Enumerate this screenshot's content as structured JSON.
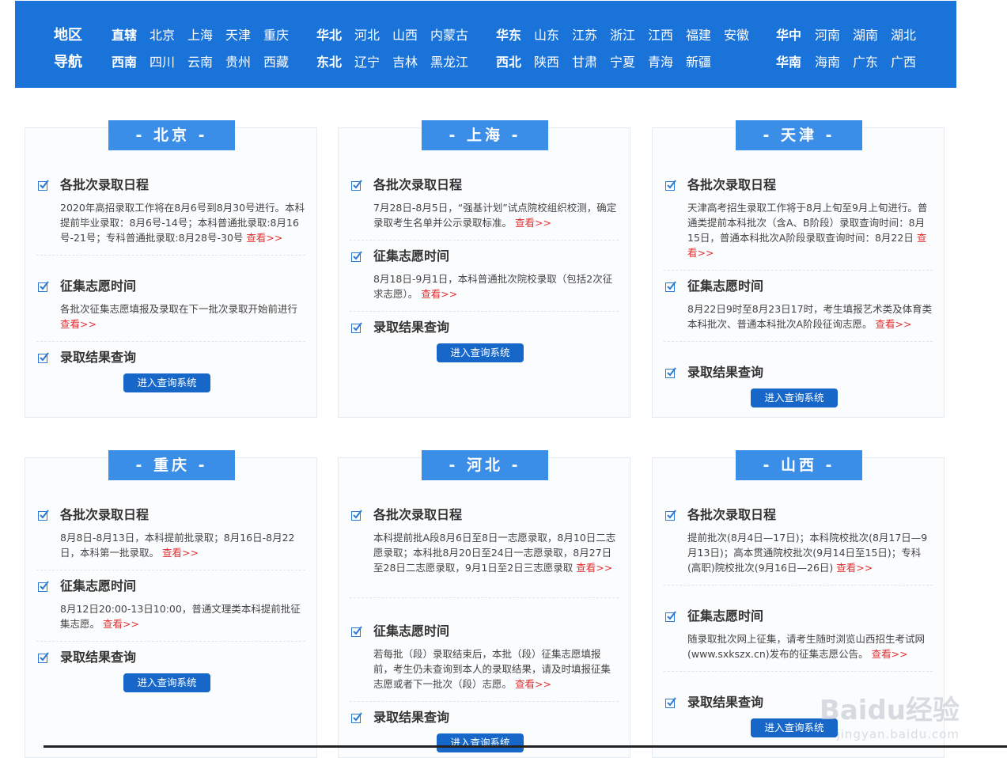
{
  "nav": {
    "title_line1": "地区",
    "title_line2": "导航",
    "row1": [
      {
        "region": "直辖",
        "provinces": [
          "北京",
          "上海",
          "天津",
          "重庆"
        ]
      },
      {
        "region": "华北",
        "provinces": [
          "河北",
          "山西",
          "内蒙古"
        ]
      },
      {
        "region": "华东",
        "provinces": [
          "山东",
          "江苏",
          "浙江",
          "江西",
          "福建",
          "安徽"
        ]
      },
      {
        "region": "华中",
        "provinces": [
          "河南",
          "湖南",
          "湖北"
        ]
      }
    ],
    "row2": [
      {
        "region": "西南",
        "provinces": [
          "四川",
          "云南",
          "贵州",
          "西藏"
        ]
      },
      {
        "region": "东北",
        "provinces": [
          "辽宁",
          "吉林",
          "黑龙江"
        ]
      },
      {
        "region": "西北",
        "provinces": [
          "陕西",
          "甘肃",
          "宁夏",
          "青海",
          "新疆"
        ]
      },
      {
        "region": "华南",
        "provinces": [
          "海南",
          "广东",
          "广西"
        ]
      }
    ]
  },
  "more_label": "查看>>",
  "query_button_label": "进入查询系统",
  "cards": [
    {
      "name": "- 北京 -",
      "schedule_title": "各批次录取日程",
      "schedule_text": "2020年高招录取工作将在8月6号到8月30号进行。本科提前毕业录取：8月6号-14号；本科普通批录取:8月16号-21号；专科普通批录取:8月28号-30号",
      "solicit_title": "征集志愿时间",
      "solicit_text": "各批次征集志愿填报及录取在下一批次录取开始前进行",
      "result_title": "录取结果查询"
    },
    {
      "name": "- 上海 -",
      "schedule_title": "各批次录取日程",
      "schedule_text": "7月28日-8月5日，“强基计划”试点院校组织校测，确定录取考生名单并公示录取标准。",
      "solicit_title": "征集志愿时间",
      "solicit_text": "8月18日-9月1日，本科普通批次院校录取（包括2次征求志愿）。",
      "result_title": "录取结果查询"
    },
    {
      "name": "- 天津 -",
      "schedule_title": "各批次录取日程",
      "schedule_text": "天津高考招生录取工作将于8月上旬至9月上旬进行。普通类提前本科批次（含A、B阶段）录取查询时间：8月15日，普通本科批次A阶段录取查询时间：8月22日",
      "solicit_title": "征集志愿时间",
      "solicit_text": "8月22日9时至8月23日17时，考生填报艺术类及体育类本科批次、普通本科批次A阶段征询志愿。",
      "result_title": "录取结果查询"
    },
    {
      "name": "- 重庆 -",
      "schedule_title": "各批次录取日程",
      "schedule_text": "8月8日-8月13日，本科提前批录取；8月16日-8月22日，本科第一批录取。",
      "solicit_title": "征集志愿时间",
      "solicit_text": "8月12日20:00-13日10:00，普通文理类本科提前批征集志愿。",
      "result_title": "录取结果查询"
    },
    {
      "name": "- 河北 -",
      "schedule_title": "各批次录取日程",
      "schedule_text": "本科提前批A段8月6日至8日一志愿录取，8月10日二志愿录取；本科批8月20日至24日一志愿录取，8月27日至28日二志愿录取，9月1日至2日三志愿录取",
      "solicit_title": "征集志愿时间",
      "solicit_text": "若每批（段）录取结束后，本批（段）征集志愿填报前，考生仍未查询到本人的录取结果，请及时填报征集志愿或者下一批次（段）志愿。",
      "result_title": "录取结果查询"
    },
    {
      "name": "- 山西 -",
      "schedule_title": "各批次录取日程",
      "schedule_text": "提前批次(8月4日—17日)；本科院校批次(8月17日—9月13日)；高本贯通院校批次(9月14日至15日)；专科(高职)院校批次(9月16日—26日)",
      "solicit_title": "征集志愿时间",
      "solicit_text": "随录取批次网上征集，请考生随时浏览山西招生考试网(www.sxkszx.cn)发布的征集志愿公告。",
      "result_title": "录取结果查询"
    }
  ],
  "watermark": {
    "logo": "Baidu经验",
    "url": "jingyan.baidu.com"
  }
}
